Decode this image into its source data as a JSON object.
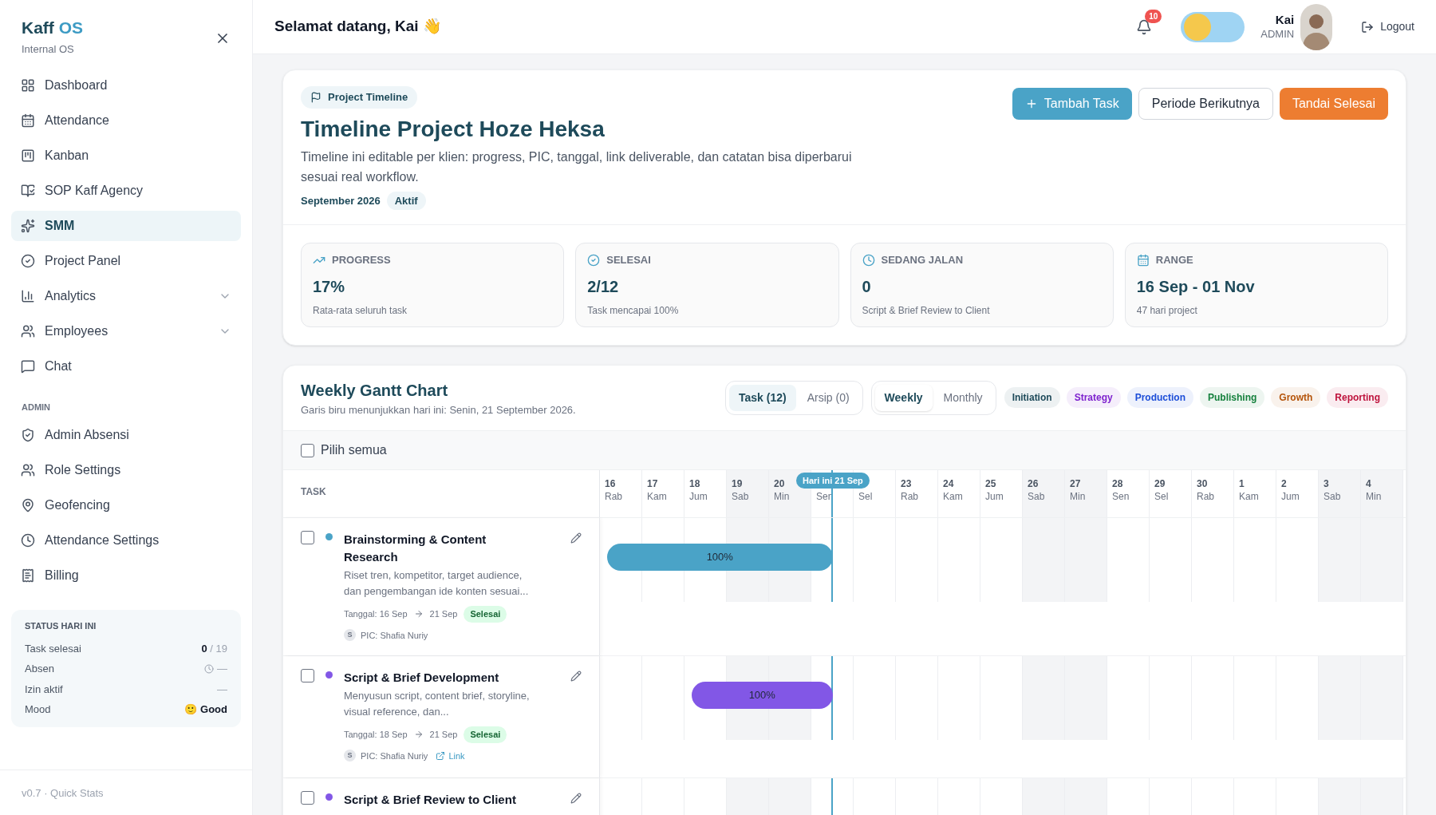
{
  "sidebar": {
    "brand": {
      "name": "Kaff",
      "suffix": "OS"
    },
    "subtitle": "Internal OS",
    "items": [
      {
        "label": "Dashboard",
        "selected": false,
        "has_submenu": false
      },
      {
        "label": "Attendance",
        "selected": false,
        "has_submenu": false
      },
      {
        "label": "Kanban",
        "selected": false,
        "has_submenu": false
      },
      {
        "label": "SOP Kaff Agency",
        "selected": false,
        "has_submenu": false
      },
      {
        "label": "SMM",
        "selected": true,
        "has_submenu": false
      },
      {
        "label": "Project Panel",
        "selected": false,
        "has_submenu": false
      },
      {
        "label": "Analytics",
        "selected": false,
        "has_submenu": true
      },
      {
        "label": "Employees",
        "selected": false,
        "has_submenu": true
      },
      {
        "label": "Chat",
        "selected": false,
        "has_submenu": false
      }
    ],
    "admin_heading": "ADMIN",
    "admin_items": [
      {
        "label": "Admin Absensi",
        "selected": false,
        "has_submenu": false
      },
      {
        "label": "Role Settings",
        "selected": false,
        "has_submenu": false
      },
      {
        "label": "Geofencing",
        "selected": false,
        "has_submenu": false
      },
      {
        "label": "Attendance Settings",
        "selected": false,
        "has_submenu": false
      },
      {
        "label": "Billing",
        "selected": false,
        "has_submenu": false
      }
    ],
    "status": {
      "title": "STATUS HARI INI",
      "rows": [
        {
          "label": "Task selesai",
          "value": "**0** / 19",
          "kind": "count"
        },
        {
          "label": "Absen",
          "value": "—",
          "kind": "clock"
        },
        {
          "label": "Izin aktif",
          "value": "—",
          "kind": "plain"
        },
        {
          "label": "Mood",
          "value": "🙂 Good",
          "kind": "mood"
        }
      ]
    },
    "footer": "v0.7 · Quick Stats"
  },
  "header": {
    "greeting": "Selamat datang, Kai 👋",
    "notifications": "10",
    "theme_toggle": {
      "on": false
    },
    "user": {
      "name": "Kai",
      "role": "ADMIN"
    },
    "logout": "Logout"
  },
  "project": {
    "tag": "Project Timeline",
    "title": "Timeline Project Hoze Heksa",
    "description": "Timeline ini editable per klien: progress, PIC, tanggal, link deliverable, dan catatan bisa diperbarui sesuai real workflow.",
    "period": "September 2026",
    "status": "Aktif",
    "buttons": [
      {
        "label": "Tambah Task",
        "kind": "primary"
      },
      {
        "label": "Periode Berikutnya",
        "kind": "outline"
      },
      {
        "label": "Tandai Selesai",
        "kind": "accent"
      }
    ],
    "stats": [
      {
        "label": "PROGRESS",
        "value": "17%",
        "note": "Rata-rata seluruh task"
      },
      {
        "label": "SELESAI",
        "value": "2/12",
        "note": "Task mencapai 100%"
      },
      {
        "label": "SEDANG JALAN",
        "value": "0",
        "note": "Script & Brief Review to Client"
      },
      {
        "label": "RANGE",
        "value": "16 Sep - 01 Nov",
        "note": "47 hari project"
      }
    ]
  },
  "gantt": {
    "title": "Weekly Gantt Chart",
    "subtitle": "Garis biru menunjukkan hari ini: Senin, 21 September 2026.",
    "list_tabs": [
      {
        "label": "Task (12)",
        "selected": true
      },
      {
        "label": "Arsip (0)",
        "selected": false
      }
    ],
    "view_tabs": [
      {
        "label": "Weekly",
        "selected": true
      },
      {
        "label": "Monthly",
        "selected": false
      }
    ],
    "phases": [
      {
        "label": "Initiation",
        "color": "#1e4a5a"
      },
      {
        "label": "Strategy",
        "color": "#7e22ce"
      },
      {
        "label": "Production",
        "color": "#1d4ed8"
      },
      {
        "label": "Publishing",
        "color": "#15803d"
      },
      {
        "label": "Growth",
        "color": "#b45309"
      },
      {
        "label": "Reporting",
        "color": "#be123c"
      }
    ],
    "select_all": {
      "label": "Pilih semua",
      "checked": false
    },
    "task_column": "TASK",
    "today_label": "Hari ini 21 Sep",
    "days": [
      {
        "date": "16",
        "day": "Rab",
        "weekend": false,
        "today": false
      },
      {
        "date": "17",
        "day": "Kam",
        "weekend": false,
        "today": false
      },
      {
        "date": "18",
        "day": "Jum",
        "weekend": false,
        "today": false
      },
      {
        "date": "19",
        "day": "Sab",
        "weekend": true,
        "today": false
      },
      {
        "date": "20",
        "day": "Min",
        "weekend": true,
        "today": false
      },
      {
        "day": "Sen",
        "weekend": false,
        "today": true
      },
      {
        "day": "Sel",
        "weekend": false,
        "today": false
      },
      {
        "date": "23",
        "day": "Rab",
        "weekend": false,
        "today": false
      },
      {
        "date": "24",
        "day": "Kam",
        "weekend": false,
        "today": false
      },
      {
        "date": "25",
        "day": "Jum",
        "weekend": false,
        "today": false
      },
      {
        "date": "26",
        "day": "Sab",
        "weekend": true,
        "today": false
      },
      {
        "date": "27",
        "day": "Min",
        "weekend": true,
        "today": false
      },
      {
        "date": "28",
        "day": "Sen",
        "weekend": false,
        "today": false
      },
      {
        "date": "29",
        "day": "Sel",
        "weekend": false,
        "today": false
      },
      {
        "date": "30",
        "day": "Rab",
        "weekend": false,
        "today": false
      },
      {
        "date": "1",
        "day": "Kam",
        "weekend": false,
        "today": false
      },
      {
        "date": "2",
        "day": "Jum",
        "weekend": false,
        "today": false
      },
      {
        "date": "3",
        "day": "Sab",
        "weekend": true,
        "today": false
      },
      {
        "date": "4",
        "day": "Min",
        "weekend": true,
        "today": false
      }
    ],
    "tasks": [
      {
        "checked": false,
        "color": "#4aa3c7",
        "title": "Brainstorming & Content Research",
        "description": "Riset tren, kompetitor, target audience, dan pengembangan ide konten sesuai...",
        "date_label": "Tanggal: 16 Sep",
        "end": "21 Sep",
        "status": "Selesai",
        "pic_initial": "S",
        "pic": "PIC: Shafia Nuriy",
        "bar": "100%"
      },
      {
        "checked": false,
        "color": "#8257e6",
        "title": "Script & Brief Development",
        "description": "Menyusun script, content brief, storyline, visual reference, dan...",
        "date_label": "Tanggal: 18 Sep",
        "end": "21 Sep",
        "status": "Selesai",
        "pic_initial": "S",
        "pic": "PIC: Shafia Nuriy",
        "link": "Link",
        "bar": "100%"
      },
      {
        "checked": false,
        "color": "#8257e6",
        "title": "Script & Brief Review to Client"
      }
    ]
  }
}
